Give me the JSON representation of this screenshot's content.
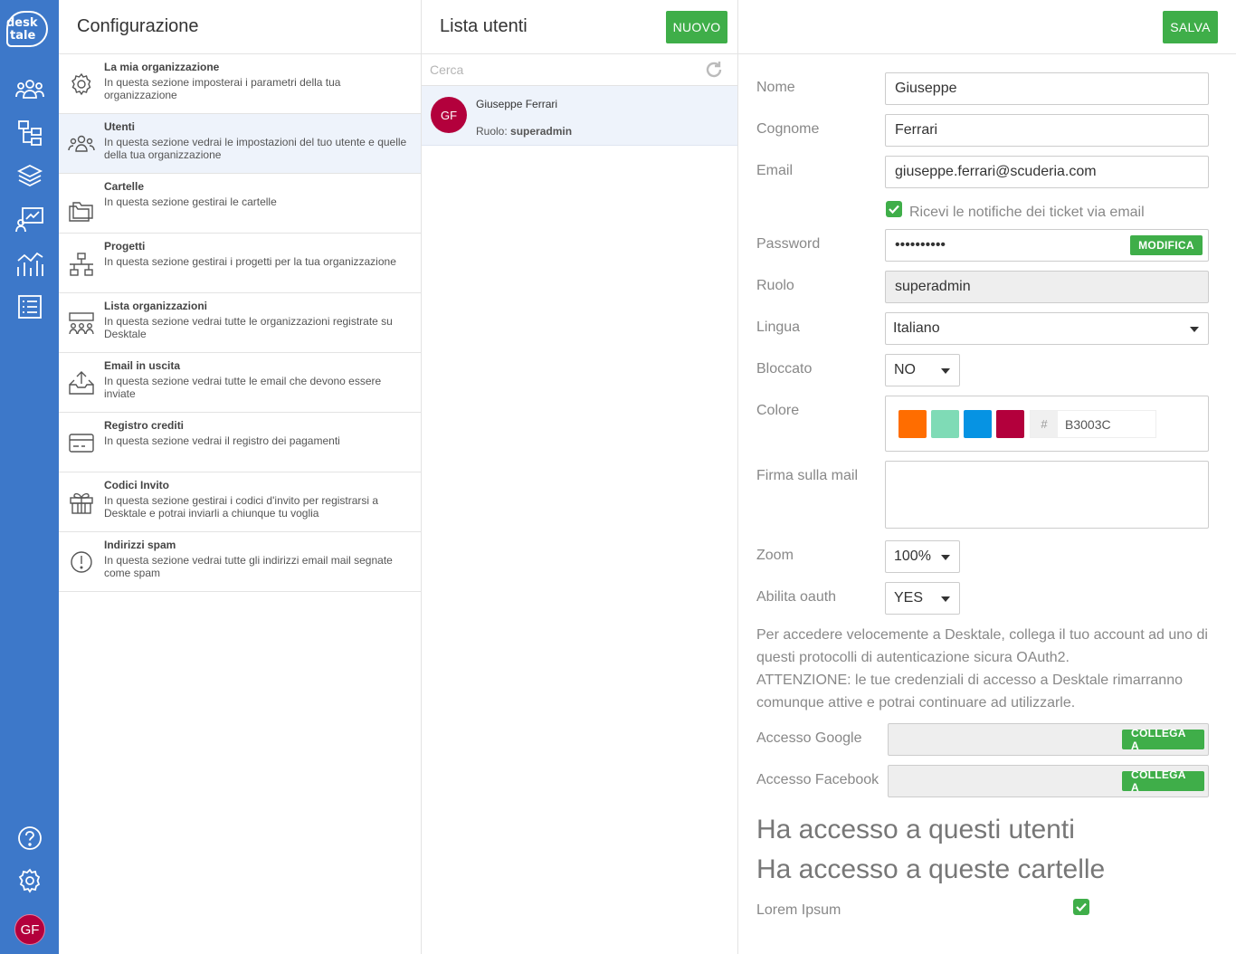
{
  "logo": {
    "line1": "desk",
    "line2": "tale"
  },
  "rail": {
    "icons": [
      "users-icon",
      "tree-icon",
      "layers-icon",
      "board-chart-icon",
      "analytics-icon",
      "list-icon",
      "help-icon",
      "settings-icon"
    ],
    "avatar": "GF"
  },
  "config": {
    "title": "Configurazione",
    "items": [
      {
        "title": "La mia organizzazione",
        "desc": "In questa sezione imposterai i parametri della tua organizzazione",
        "icon": "gear-icon"
      },
      {
        "title": "Utenti",
        "desc": "In questa sezione vedrai le impostazioni del tuo utente e quelle della tua organizzazione",
        "icon": "users-icon"
      },
      {
        "title": "Cartelle",
        "desc": "In questa sezione gestirai le cartelle",
        "icon": "folder-icon"
      },
      {
        "title": "Progetti",
        "desc": "In questa sezione gestirai i progetti per la tua organizzazione",
        "icon": "org-chart-icon"
      },
      {
        "title": "Lista organizzazioni",
        "desc": "In questa sezione vedrai tutte le organizzazioni registrate su Desktale",
        "icon": "organizations-icon"
      },
      {
        "title": "Email in uscita",
        "desc": "In questa sezione vedrai tutte le email che devono essere inviate",
        "icon": "outbox-icon"
      },
      {
        "title": "Registro crediti",
        "desc": "In questa sezione vedrai il registro dei pagamenti",
        "icon": "credit-card-icon"
      },
      {
        "title": "Codici Invito",
        "desc": "In questa sezione gestirai i codici d'invito per registrarsi a Desktale e potrai inviarli a chiunque tu voglia",
        "icon": "gift-icon"
      },
      {
        "title": "Indirizzi spam",
        "desc": "In questa sezione vedrai tutte gli indirizzi email mail segnate come spam",
        "icon": "alert-icon"
      }
    ]
  },
  "users": {
    "title": "Lista utenti",
    "new_label": "NUOVO",
    "search_placeholder": "Cerca",
    "list": [
      {
        "initials": "GF",
        "name": "Giuseppe Ferrari",
        "role_label": "Ruolo: ",
        "role": "superadmin"
      }
    ]
  },
  "detail": {
    "save_label": "SALVA",
    "labels": {
      "nome": "Nome",
      "cognome": "Cognome",
      "email": "Email",
      "password": "Password",
      "ruolo": "Ruolo",
      "lingua": "Lingua",
      "bloccato": "Bloccato",
      "colore": "Colore",
      "firma": "Firma sulla mail",
      "zoom": "Zoom",
      "oauth": "Abilita oauth",
      "google": "Accesso Google",
      "facebook": "Accesso Facebook"
    },
    "values": {
      "nome": "Giuseppe",
      "cognome": "Ferrari",
      "email": "giuseppe.ferrari@scuderia.com",
      "password": "••••••••••",
      "ruolo": "superadmin",
      "lingua": "Italiano",
      "bloccato": "NO",
      "zoom": "100%",
      "oauth": "YES",
      "colore_hash": "#",
      "colore_hex": "B3003C"
    },
    "notify_label": "Ricevi le notifiche dei ticket via email",
    "notify_checked": true,
    "modifica_label": "MODIFICA",
    "swatches": [
      "#ff6d00",
      "#7fdbb6",
      "#0693e3",
      "#b3003c"
    ],
    "oauth_text_1": "Per accedere velocemente a Desktale, collega il tuo account ad uno di questi protocolli di autenticazione sicura OAuth2.",
    "oauth_text_2": "ATTENZIONE: le tue credenziali di accesso a Desktale rimarranno comunque attive e potrai continuare ad utilizzarle.",
    "collega_label": "COLLEGA A",
    "users_access_title": "Ha accesso a questi utenti",
    "folders_access_title": "Ha accesso a queste cartelle",
    "folders": [
      {
        "name": "Lorem Ipsum",
        "checked": true
      }
    ]
  }
}
